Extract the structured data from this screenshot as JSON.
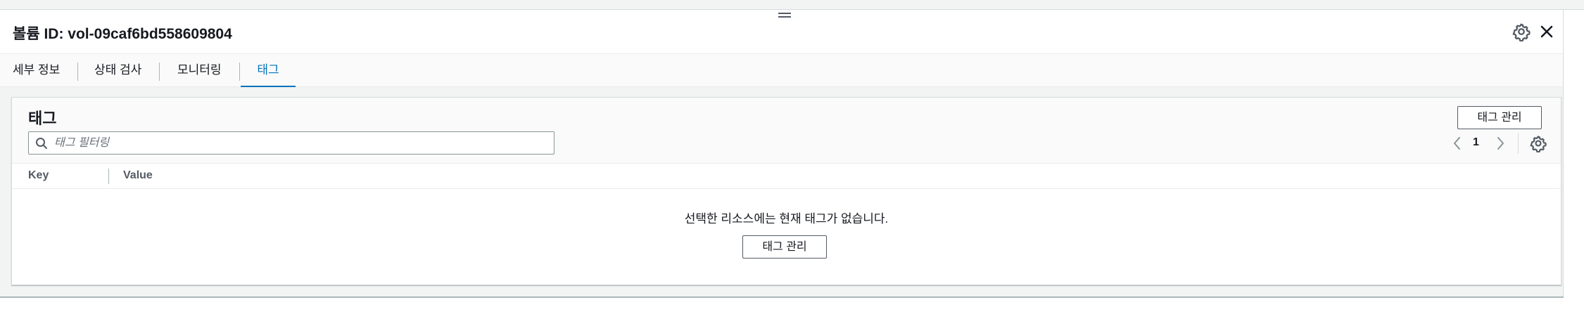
{
  "panel": {
    "title": "볼륨 ID: vol-09caf6bd558609804"
  },
  "header_icons": {
    "settings": "gear-icon",
    "close": "close-icon"
  },
  "tabs": [
    {
      "label": "세부 정보",
      "active": false
    },
    {
      "label": "상태 검사",
      "active": false
    },
    {
      "label": "모니터링",
      "active": false
    },
    {
      "label": "태그",
      "active": true
    }
  ],
  "tags_section": {
    "title": "태그",
    "manage_button": "태그 관리",
    "filter": {
      "placeholder": "태그 필터링",
      "value": ""
    },
    "pagination": {
      "current_page": "1"
    },
    "table": {
      "columns": [
        "Key",
        "Value"
      ],
      "rows": []
    },
    "empty": {
      "message": "선택한 리소스에는 현재 태그가 없습니다.",
      "button": "태그 관리"
    }
  },
  "colors": {
    "accent": "#0073bb",
    "text": "#16191f",
    "border": "#d5dbdb",
    "background": "#f2f3f3"
  }
}
